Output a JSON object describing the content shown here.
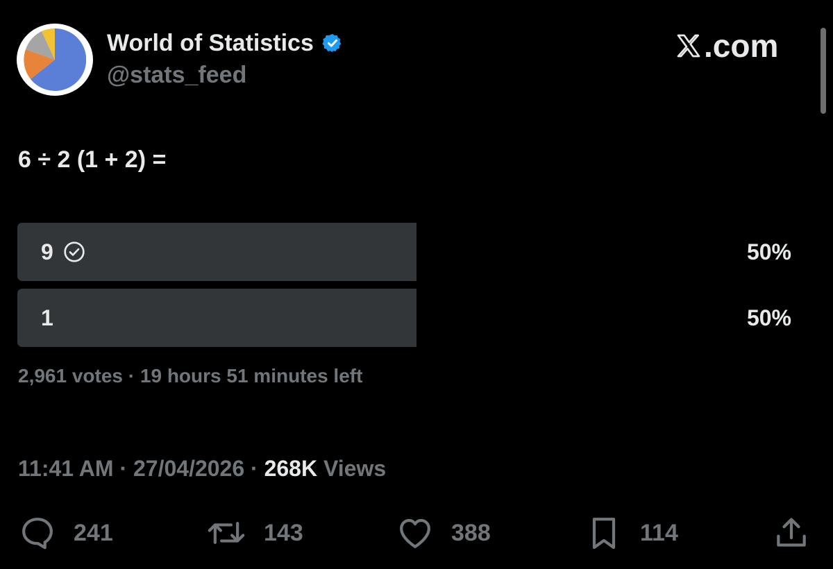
{
  "account": {
    "display_name": "World of Statistics",
    "handle": "@stats_feed",
    "verified": true,
    "avatar": "pie-chart-logo"
  },
  "brand": {
    "text": ".com",
    "mark": "x-logo"
  },
  "tweet": {
    "text": "6 ÷ 2 (1 + 2) ="
  },
  "poll": {
    "options": [
      {
        "label": "9",
        "percent_label": "50%",
        "percent": 50,
        "selected": true,
        "selected_icon": "check-circle-icon"
      },
      {
        "label": "1",
        "percent_label": "50%",
        "percent": 50,
        "selected": false
      }
    ],
    "votes": "2,961 votes",
    "separator": "·",
    "time_left": "19 hours 51 minutes left"
  },
  "meta": {
    "time": "11:41 AM",
    "date": "27/04/2026",
    "separator": "·",
    "views_count": "268K",
    "views_label": "Views"
  },
  "actions": {
    "replies": "241",
    "reposts": "143",
    "likes": "388",
    "bookmarks": "114"
  },
  "colors": {
    "background": "#000000",
    "primary_text": "#e7e9ea",
    "secondary_text": "#71767b",
    "poll_bar": "#333639",
    "verified_badge": "#1d9bf0",
    "avatar_blue": "#5b7fd6",
    "avatar_orange": "#e8833a",
    "avatar_gray": "#a5a5a5",
    "avatar_yellow": "#f2c230"
  }
}
